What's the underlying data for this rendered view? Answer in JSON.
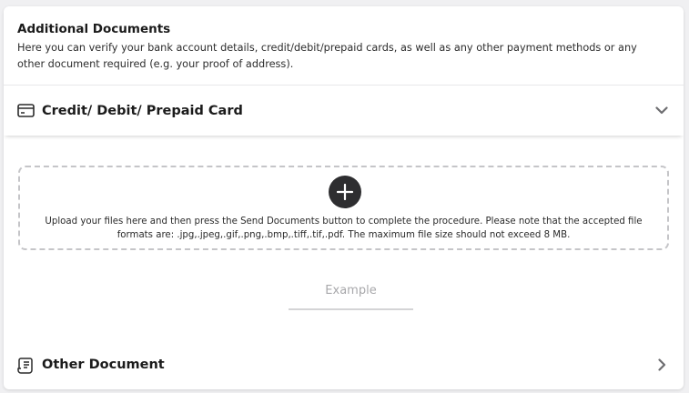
{
  "header": {
    "title": "Additional Documents",
    "description": "Here you can verify your bank account details, credit/debit/prepaid cards, as well as any other payment methods or any other document required (e.g. your proof of address)."
  },
  "sections": {
    "card": {
      "title": "Credit/ Debit/ Prepaid Card",
      "icon": "credit-card-icon",
      "expanded": true
    },
    "other": {
      "title": "Other Document",
      "icon": "document-icon",
      "expanded": false
    }
  },
  "upload": {
    "icon": "plus-icon",
    "text": "Upload your files here and then press the Send Documents button to complete the procedure. Please note that the accepted file formats are: .jpg,.jpeg,.gif,.png,.bmp,.tiff,.tif,.pdf. The maximum file size should not exceed 8 MB."
  },
  "example_button": {
    "label": "Example"
  },
  "colors": {
    "background": "#f0f0f2",
    "card": "#ffffff",
    "plus_button": "#2e2e30",
    "dashed_border": "#c5c5c8",
    "muted_text": "#a8a8ab"
  }
}
